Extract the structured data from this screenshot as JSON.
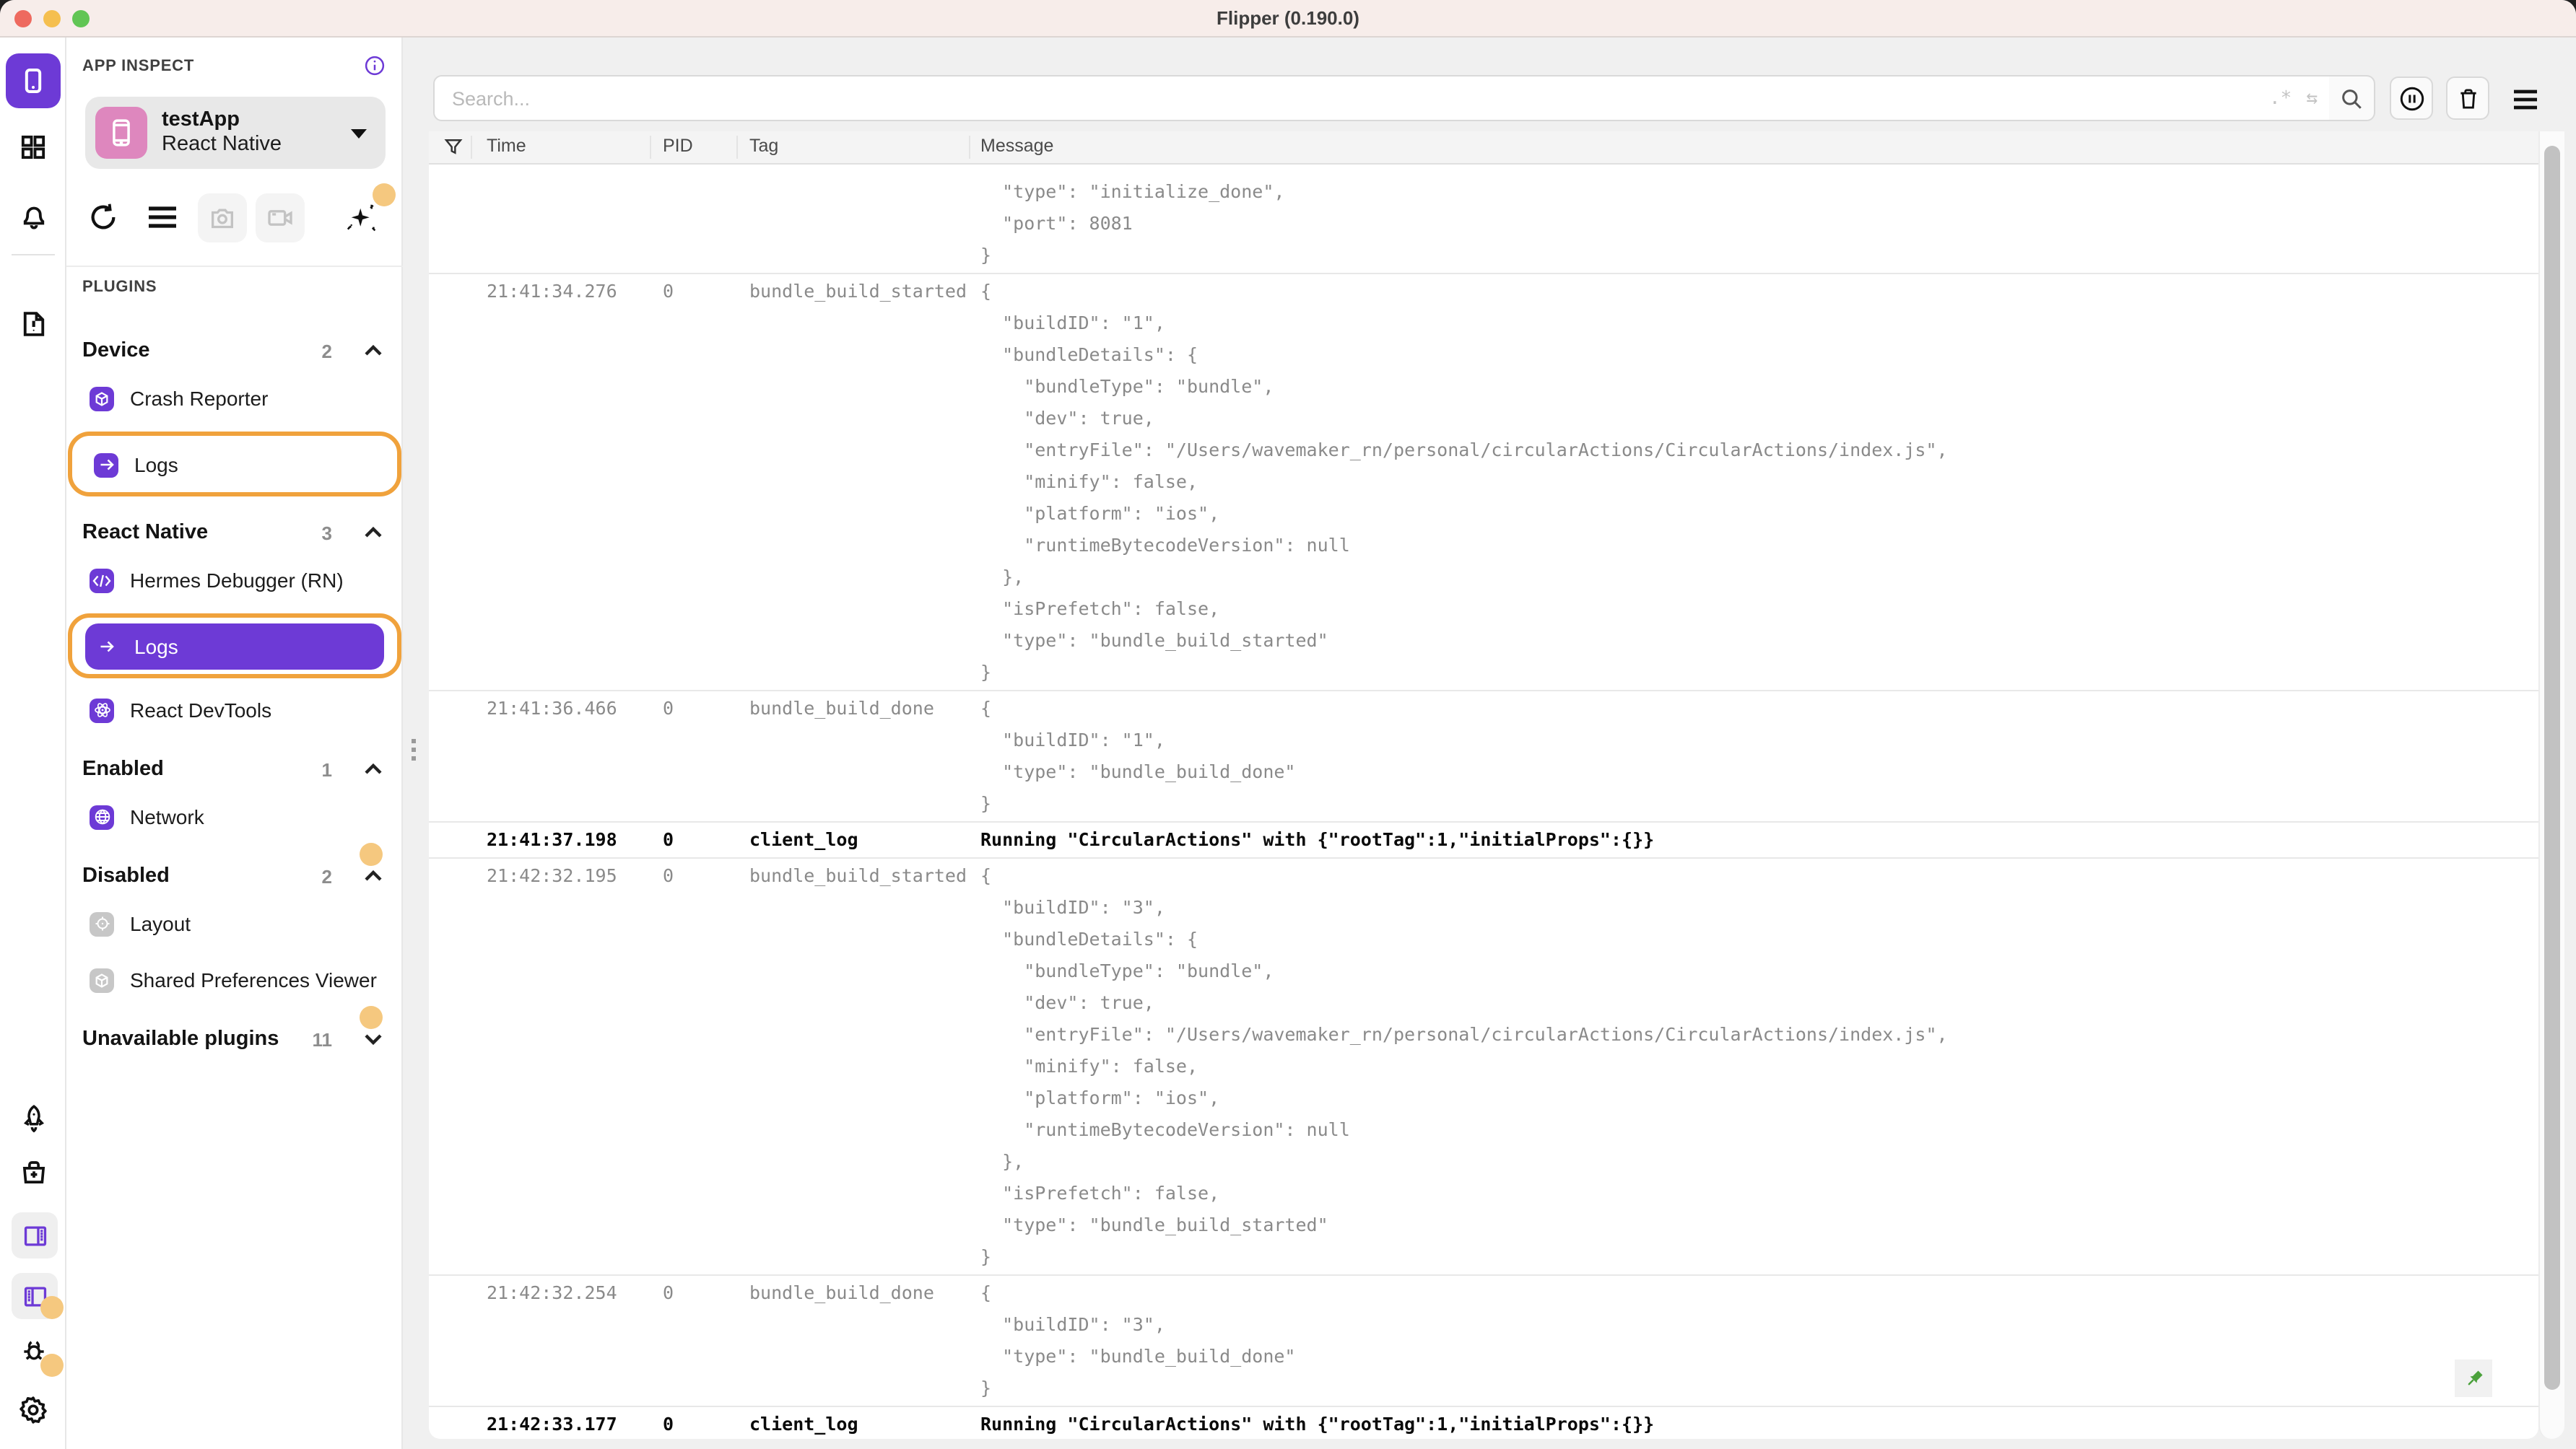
{
  "window": {
    "title": "Flipper (0.190.0)"
  },
  "colors": {
    "accent_purple": "#6d3ad6",
    "highlight_ring_orange": "#f0a23c",
    "badge_dot_orange": "#f5c87f",
    "pin_green": "#4ba13c",
    "titlebar_pink": "#f7edea"
  },
  "rail": {
    "items": [
      {
        "icon": "app-phone-icon",
        "selected": true
      },
      {
        "icon": "grid-icon"
      },
      {
        "icon": "bell-icon"
      },
      {
        "icon": "doc-alert-icon"
      },
      {
        "icon": "rocket-icon"
      },
      {
        "icon": "medkit-icon"
      },
      {
        "icon": "panel-right-icon"
      },
      {
        "icon": "panel-left-icon"
      },
      {
        "icon": "bug-icon",
        "badge_dot": true
      },
      {
        "icon": "gear-icon",
        "badge_dot": true
      }
    ]
  },
  "sidebar": {
    "app_inspect_label": "APP INSPECT",
    "app": {
      "name": "testApp",
      "platform": "React Native"
    },
    "plugins_label": "PLUGINS",
    "toolbar_icons": [
      "refresh-icon",
      "menu-icon",
      "camera-icon",
      "video-icon",
      "sparkle-icon"
    ],
    "sections": [
      {
        "label": "Device",
        "count": "2",
        "expanded": true,
        "items": [
          {
            "label": "Crash Reporter",
            "icon": "cube-icon",
            "style": "purple"
          },
          {
            "label": "Logs",
            "icon": "arrow-right-icon",
            "style": "purple",
            "highlight_ring": true
          }
        ]
      },
      {
        "label": "React Native",
        "count": "3",
        "expanded": true,
        "items": [
          {
            "label": "Hermes Debugger (RN)",
            "icon": "code-icon",
            "style": "purple"
          },
          {
            "label": "Logs",
            "icon": "arrow-right-icon",
            "style": "purple",
            "selected": true,
            "highlight_ring": true
          },
          {
            "label": "React DevTools",
            "icon": "atom-icon",
            "style": "purple"
          }
        ]
      },
      {
        "label": "Enabled",
        "count": "1",
        "expanded": true,
        "items": [
          {
            "label": "Network",
            "icon": "globe-icon",
            "style": "purple"
          }
        ]
      },
      {
        "label": "Disabled",
        "count": "2",
        "expanded": true,
        "badge_dot": true,
        "items": [
          {
            "label": "Layout",
            "icon": "target-icon",
            "style": "gray"
          },
          {
            "label": "Shared Preferences Viewer",
            "icon": "cube-icon",
            "style": "gray"
          }
        ]
      },
      {
        "label": "Unavailable plugins",
        "count": "11",
        "expanded": false,
        "badge_dot": true,
        "items": []
      }
    ]
  },
  "toolbar": {
    "search_placeholder": "Search...",
    "regex_icon_text": ".*",
    "swap_icon_text": "⇆"
  },
  "table": {
    "columns": [
      "Time",
      "PID",
      "Tag",
      "Message"
    ],
    "rows": [
      {
        "time": "",
        "pid": "",
        "tag": "",
        "clipped": true,
        "message_lines": [
          "  \"type\": \"initialize_done\",",
          "  \"port\": 8081",
          "}"
        ]
      },
      {
        "time": "21:41:34.276",
        "pid": "0",
        "tag": "bundle_build_started",
        "message_lines": [
          "{",
          "  \"buildID\": \"1\",",
          "  \"bundleDetails\": {",
          "    \"bundleType\": \"bundle\",",
          "    \"dev\": true,",
          "    \"entryFile\": \"/Users/wavemaker_rn/personal/circularActions/CircularActions/index.js\",",
          "    \"minify\": false,",
          "    \"platform\": \"ios\",",
          "    \"runtimeBytecodeVersion\": null",
          "  },",
          "  \"isPrefetch\": false,",
          "  \"type\": \"bundle_build_started\"",
          "}"
        ]
      },
      {
        "time": "21:41:36.466",
        "pid": "0",
        "tag": "bundle_build_done",
        "message_lines": [
          "{",
          "  \"buildID\": \"1\",",
          "  \"type\": \"bundle_build_done\"",
          "}"
        ]
      },
      {
        "time": "21:41:37.198",
        "pid": "0",
        "tag": "client_log",
        "strong": true,
        "message_lines": [
          "Running \"CircularActions\" with {\"rootTag\":1,\"initialProps\":{}}"
        ]
      },
      {
        "time": "21:42:32.195",
        "pid": "0",
        "tag": "bundle_build_started",
        "message_lines": [
          "{",
          "  \"buildID\": \"3\",",
          "  \"bundleDetails\": {",
          "    \"bundleType\": \"bundle\",",
          "    \"dev\": true,",
          "    \"entryFile\": \"/Users/wavemaker_rn/personal/circularActions/CircularActions/index.js\",",
          "    \"minify\": false,",
          "    \"platform\": \"ios\",",
          "    \"runtimeBytecodeVersion\": null",
          "  },",
          "  \"isPrefetch\": false,",
          "  \"type\": \"bundle_build_started\"",
          "}"
        ]
      },
      {
        "time": "21:42:32.254",
        "pid": "0",
        "tag": "bundle_build_done",
        "message_lines": [
          "{",
          "  \"buildID\": \"3\",",
          "  \"type\": \"bundle_build_done\"",
          "}"
        ]
      },
      {
        "time": "21:42:33.177",
        "pid": "0",
        "tag": "client_log",
        "strong": true,
        "message_lines": [
          "Running \"CircularActions\" with {\"rootTag\":1,\"initialProps\":{}}"
        ]
      }
    ]
  }
}
